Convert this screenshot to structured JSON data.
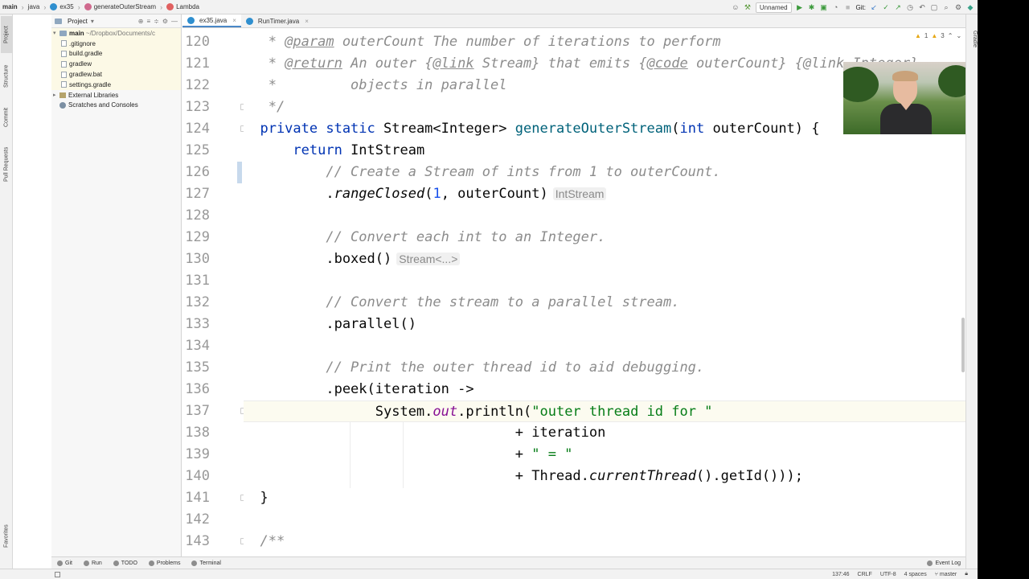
{
  "breadcrumbs": [
    "main",
    "java",
    "ex35",
    "generateOuterStream",
    "Lambda"
  ],
  "toolbar": {
    "run_config": "Unnamed",
    "git_label": "Git:"
  },
  "left_tabs": [
    "Project",
    "Structure",
    "Commit",
    "Pull Requests",
    "Favorites"
  ],
  "right_tabs": [
    "Gradle"
  ],
  "project": {
    "dropdown": "Project",
    "root_name": "main",
    "root_path": "~/Dropbox/Documents/c",
    "files": [
      ".gitignore",
      "build.gradle",
      "gradlew",
      "gradlew.bat",
      "settings.gradle"
    ],
    "external": "External Libraries",
    "scratches": "Scratches and Consoles"
  },
  "tabs": [
    {
      "label": "ex35.java"
    },
    {
      "label": "RunTimer.java"
    }
  ],
  "inspections": {
    "warnings": "1",
    "weak": "3"
  },
  "line_numbers": [
    "120",
    "121",
    "122",
    "123",
    "124",
    "125",
    "126",
    "127",
    "128",
    "129",
    "130",
    "131",
    "132",
    "133",
    "134",
    "135",
    "136",
    "137",
    "138",
    "139",
    "140",
    "141",
    "142",
    "143"
  ],
  "code": {
    "l120_star": "   * ",
    "l120_tag": "@param",
    "l120_rest": " outerCount The number of iterations to perform",
    "l121_star": "   * ",
    "l121_tag": "@return",
    "l121_a": " An outer {",
    "l121_link": "@link",
    "l121_b": " Stream} that emits {",
    "l121_code": "@code",
    "l121_c": " outerCount} {@link Integer}",
    "l122": "   *         objects in parallel",
    "l123": "   */",
    "l124_kw": "  private static",
    "l124_type": " Stream<Integer> ",
    "l124_fn": "generateOuterStream",
    "l124_rest": "(",
    "l124_kw2": "int",
    "l124_param": " outerCount) {",
    "l125_kw": "      return",
    "l125_rest": " IntStream",
    "l126": "          // Create a Stream of ints from 1 to outerCount.",
    "l127_dot": "          .",
    "l127_m": "rangeClosed",
    "l127_a": "(",
    "l127_num": "1",
    "l127_b": ", outerCount)",
    "l127_hint": "IntStream",
    "l129": "          // Convert each int to an Integer.",
    "l130": "          .boxed()",
    "l130_hint": "Stream<...>",
    "l132": "          // Convert the stream to a parallel stream.",
    "l133": "          .parallel()",
    "l135": "          // Print the outer thread id to aid debugging.",
    "l136": "          .peek(iteration ->",
    "l137_a": "                System.",
    "l137_fld": "out",
    "l137_b": ".println(",
    "l137_str": "\"outer thread id for \"",
    "l138": "                                 + iteration",
    "l139_a": "                                 + ",
    "l139_str": "\" = \"",
    "l140_a": "                                 + Thread.",
    "l140_m": "currentThread",
    "l140_b": "().getId()));",
    "l141": "  }",
    "l143": "  /**"
  },
  "bottom_tabs": [
    "Git",
    "Run",
    "TODO",
    "Problems",
    "Terminal"
  ],
  "event_log": "Event Log",
  "status": {
    "position": "137:46",
    "line_sep": "CRLF",
    "encoding": "UTF-8",
    "indent": "4 spaces",
    "branch": "master"
  }
}
